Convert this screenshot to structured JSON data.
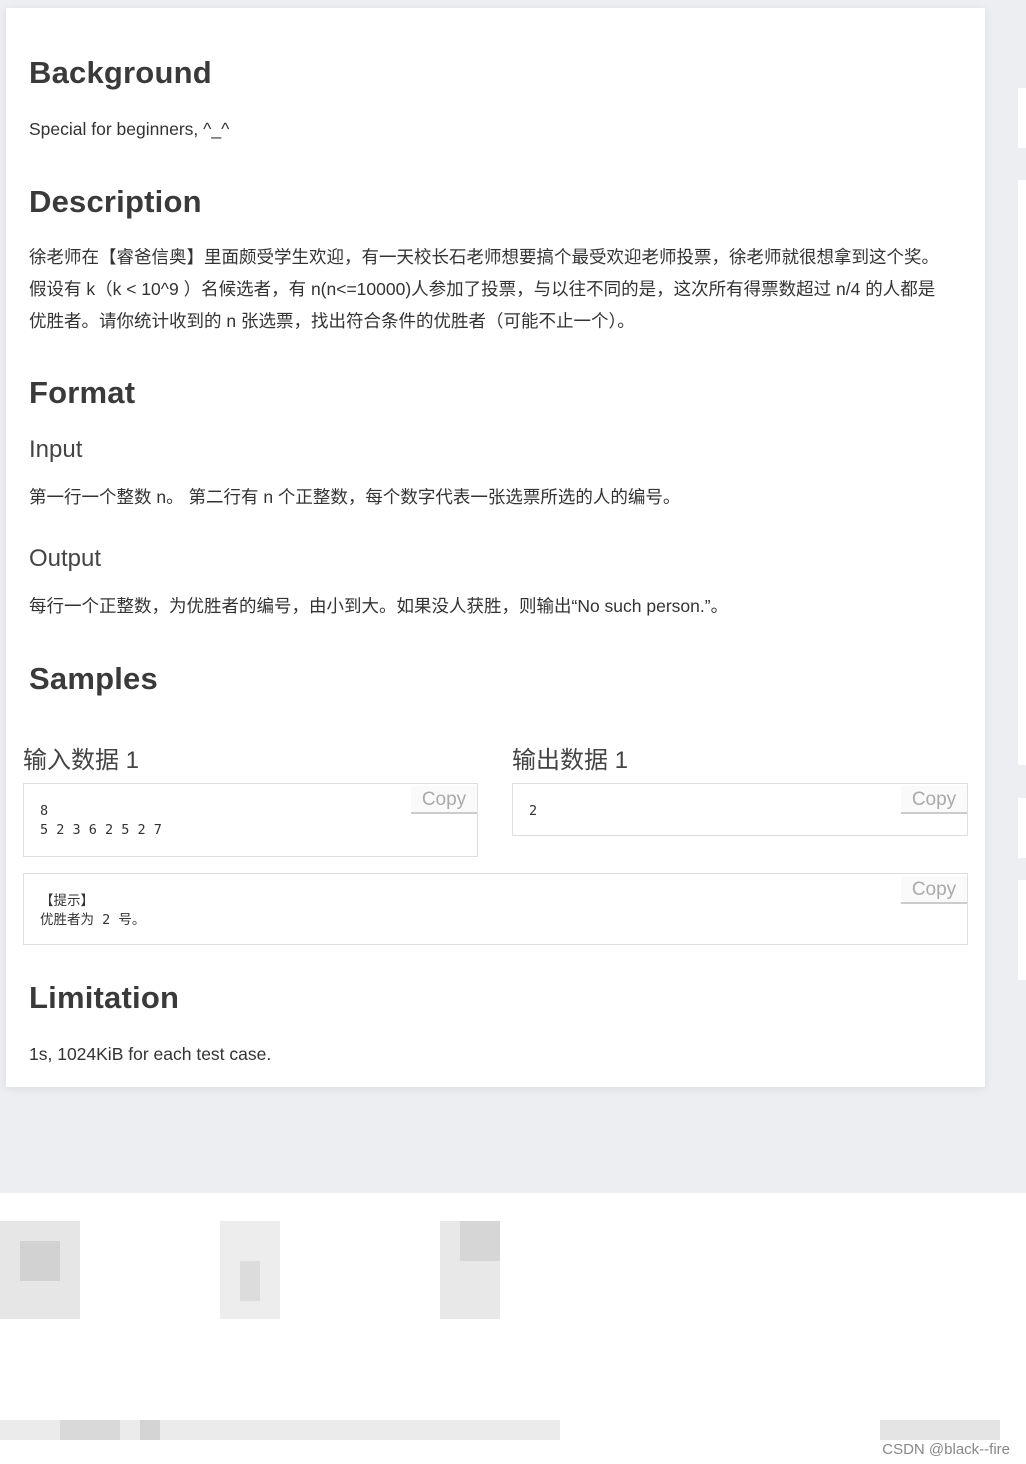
{
  "sections": {
    "background": {
      "title": "Background",
      "text": "Special for beginners, ^_^"
    },
    "description": {
      "title": "Description",
      "lines": [
        "徐老师在【睿爸信奥】里面颇受学生欢迎，有一天校长石老师想要搞个最受欢迎老师投票，徐老师就很想拿到这个奖。",
        "假设有 k（k < 10^9 ）名候选者，有 n(n<=10000)人参加了投票，与以往不同的是，这次所有得票数超过 n/4 的人都是",
        "优胜者。请你统计收到的 n 张选票，找出符合条件的优胜者（可能不止一个）。"
      ]
    },
    "format": {
      "title": "Format",
      "input_title": "Input",
      "input_text": "第一行一个整数 n。 第二行有 n 个正整数，每个数字代表一张选票所选的人的编号。",
      "output_title": "Output",
      "output_text": "每行一个正整数，为优胜者的编号，由小到大。如果没人获胜，则输出“No such person.”。"
    },
    "samples": {
      "title": "Samples",
      "input_label": "输入数据 1",
      "output_label": "输出数据 1",
      "input_data": "8\n5 2 3 6 2 5 2 7",
      "output_data": "2",
      "hint": "【提示】\n优胜者为 2 号。",
      "copy_label": "Copy"
    },
    "limitation": {
      "title": "Limitation",
      "text": "1s, 1024KiB for each test case."
    }
  },
  "watermark": "CSDN @black--fire"
}
